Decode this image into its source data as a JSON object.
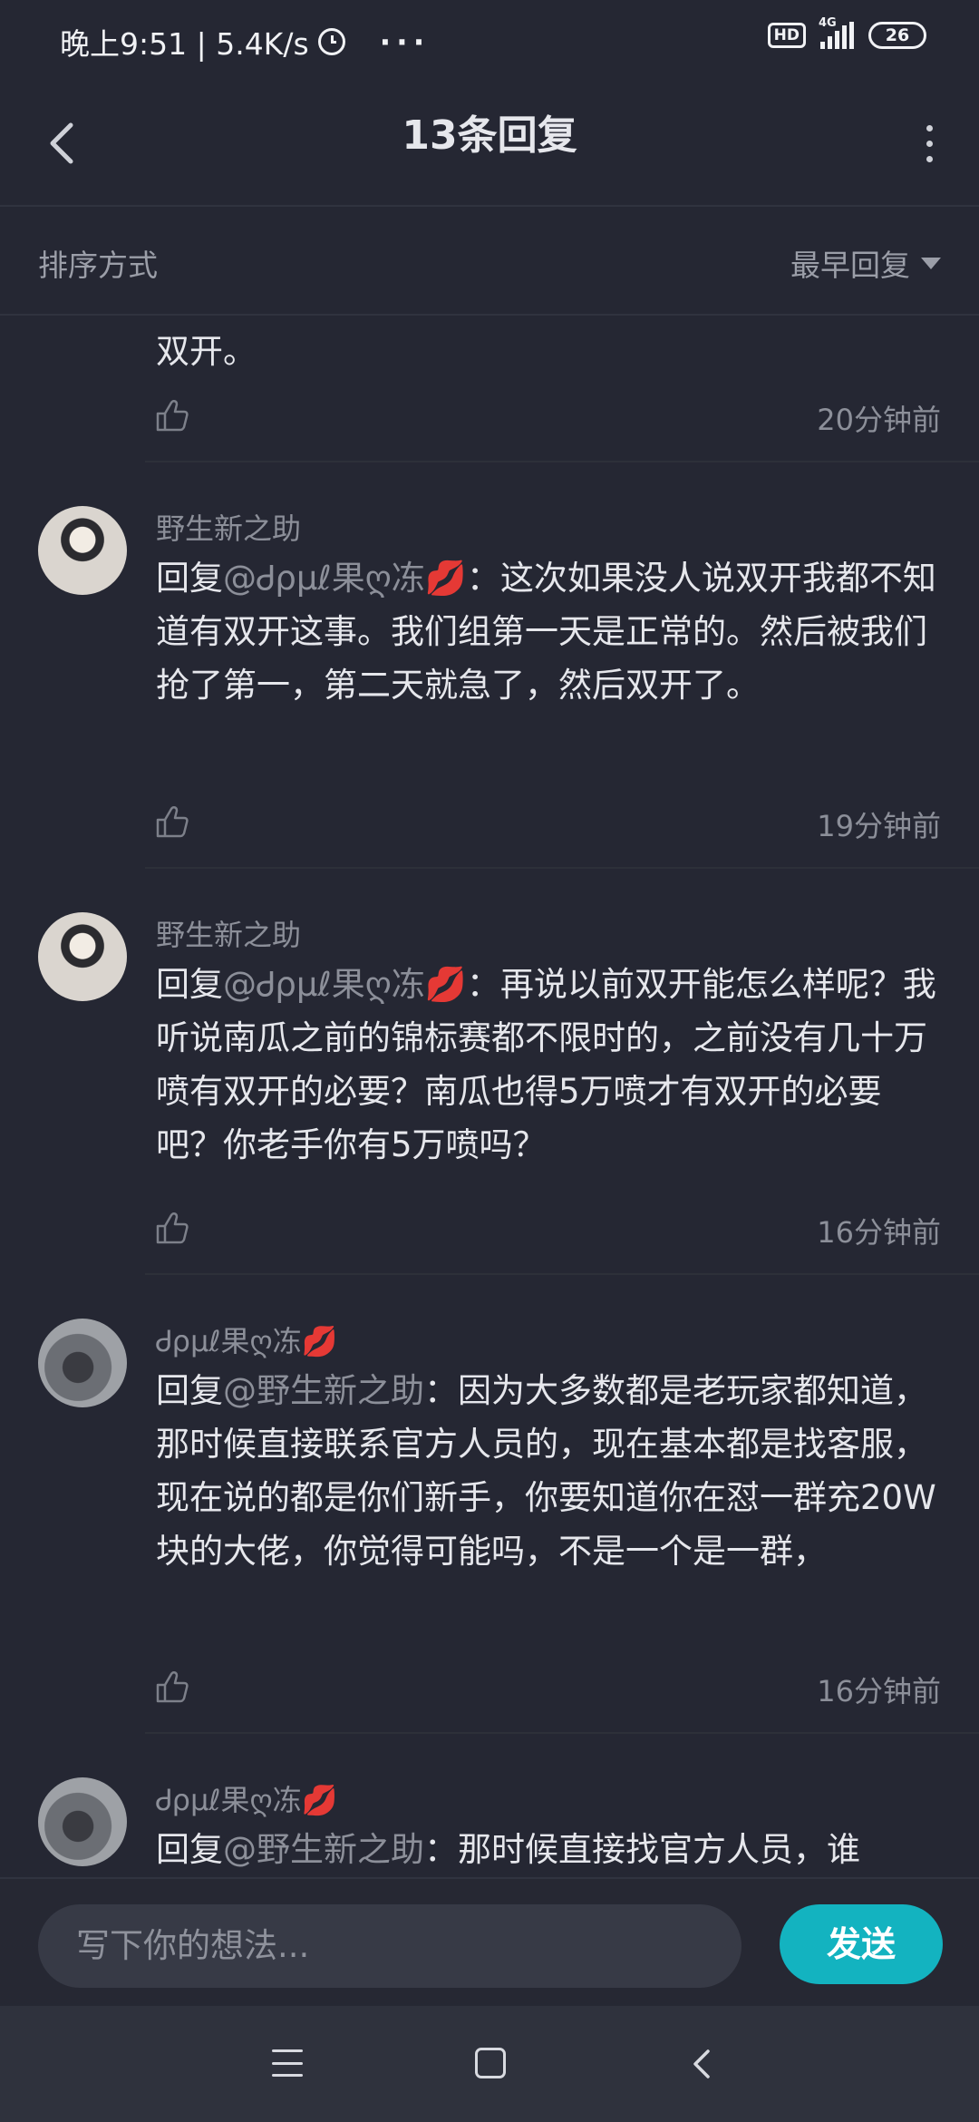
{
  "status_bar": {
    "time_speed": "晚上9:51 | 5.4K/s",
    "dots": "···",
    "hd": "HD",
    "network": "4G",
    "battery": "26"
  },
  "header": {
    "title": "13条回复"
  },
  "sort": {
    "label": "排序方式",
    "value": "最早回复"
  },
  "comments": [
    {
      "text": "双开。",
      "time": "20分钟前"
    },
    {
      "name": "野生新之助",
      "reply_prefix": "回复",
      "mention": "@Ꮷρμℓ果ღ冻",
      "mention_emoji": "💋",
      "text": "：这次如果没人说双开我都不知道有双开这事。我们组第一天是正常的。然后被我们抢了第一，第二天就急了，然后双开了。",
      "time": "19分钟前"
    },
    {
      "name": "野生新之助",
      "reply_prefix": "回复",
      "mention": "@Ꮷρμℓ果ღ冻",
      "mention_emoji": "💋",
      "text": "：再说以前双开能怎么样呢？我听说南瓜之前的锦标赛都不限时的，之前没有几十万喷有双开的必要？南瓜也得5万喷才有双开的必要吧？你老手你有5万喷吗？",
      "time": "16分钟前"
    },
    {
      "name": "Ꮷρμℓ果ღ冻",
      "name_emoji": "💋",
      "reply_prefix": "回复",
      "mention": "@野生新之助",
      "text": "：因为大多数都是老玩家都知道，那时候直接联系官方人员的，现在基本都是找客服，现在说的都是你们新手，你要知道你在怼一群充20W块的大佬，你觉得可能吗，不是一个是一群，",
      "time": "16分钟前"
    },
    {
      "name": "Ꮷρμℓ果ღ冻",
      "name_emoji": "💋",
      "reply_prefix": "回复",
      "mention": "@野生新之助",
      "text": "：那时候直接找官方人员，谁"
    }
  ],
  "input": {
    "placeholder": "写下你的想法...",
    "send_label": "发送"
  },
  "colors": {
    "background": "#252733",
    "accent": "#13b3c0",
    "secondary_text": "#8c8f99"
  }
}
